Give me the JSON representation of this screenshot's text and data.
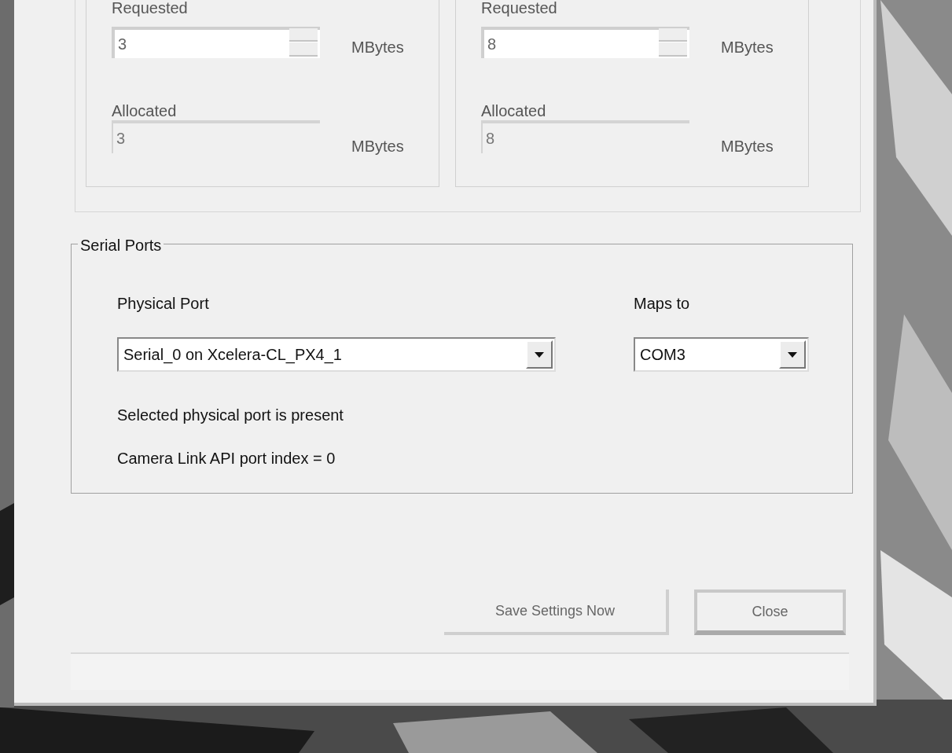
{
  "memory_groups": [
    {
      "requested_label": "Requested",
      "requested_value": "3",
      "requested_unit": "MBytes",
      "allocated_label": "Allocated",
      "allocated_value": "3",
      "allocated_unit": "MBytes"
    },
    {
      "requested_label": "Requested",
      "requested_value": "8",
      "requested_unit": "MBytes",
      "allocated_label": "Allocated",
      "allocated_value": "8",
      "allocated_unit": "MBytes"
    }
  ],
  "serial_ports": {
    "title": "Serial Ports",
    "physical_port_label": "Physical Port",
    "physical_port": "Serial_0 on Xcelera-CL_PX4_1",
    "maps_to_label": "Maps to",
    "maps_to": "COM3",
    "status": "Selected physical port is present",
    "port_index": "Camera Link API port index = 0"
  },
  "buttons": [
    {
      "label": "Save Settings Now",
      "kind": "flat"
    },
    {
      "label": "Close",
      "kind": "default"
    }
  ]
}
